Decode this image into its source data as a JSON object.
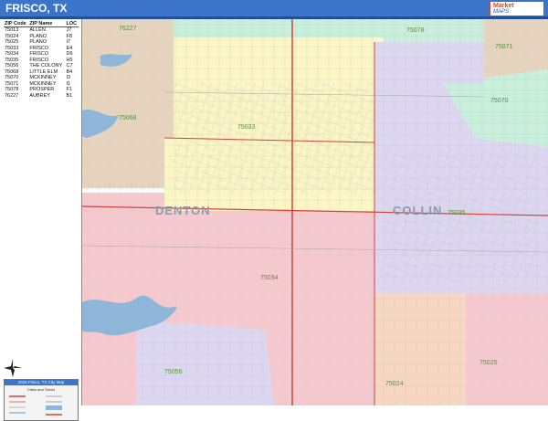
{
  "header": {
    "title": "FRISCO, TX",
    "logo_line1": "Market",
    "logo_line2": "MAPS"
  },
  "index": {
    "columns": [
      "ZIP Code",
      "ZIP Name",
      "LOC"
    ],
    "rows": [
      [
        "75013",
        "ALLEN",
        "J7"
      ],
      [
        "75024",
        "PLANO",
        "F8"
      ],
      [
        "75025",
        "PLANO",
        "I7"
      ],
      [
        "75033",
        "FRISCO",
        "E4"
      ],
      [
        "75034",
        "FRISCO",
        "D6"
      ],
      [
        "75035",
        "FRISCO",
        "H5"
      ],
      [
        "75056",
        "THE COLONY",
        "C7"
      ],
      [
        "75068",
        "LITTLE ELM",
        "B4"
      ],
      [
        "75070",
        "MCKINNEY",
        "I3"
      ],
      [
        "75071",
        "MCKINNEY",
        "I1"
      ],
      [
        "75078",
        "PROSPER",
        "F1"
      ],
      [
        "76227",
        "AUBREY",
        "B1"
      ]
    ]
  },
  "legend": {
    "title": "2016 Frisco, TX City Map",
    "subtitle": "Cities and Towns"
  },
  "map": {
    "zip_labels": {
      "z76227": "76227",
      "z75078": "75078",
      "z75071": "75071",
      "z75070": "75070",
      "z75068": "75068",
      "z75033": "75033",
      "z75035": "75035",
      "z75034": "75034",
      "z75056": "75056",
      "z75024": "75024",
      "z75025": "75025"
    },
    "counties": {
      "west": "DENTON",
      "east": "COLLIN"
    }
  },
  "colors": {
    "title_bar": "#3b74c9",
    "zip_pink": "#f6c9cf",
    "zip_yellow": "#fbf6c4",
    "zip_lavender": "#dcd6f1",
    "zip_mint": "#c8f0dc",
    "zip_tan": "#e7d4be",
    "zip_peach": "#f7d7c2",
    "lake": "#8fb6d8",
    "highway": "#d9413b",
    "road": "#a7a7a7"
  }
}
